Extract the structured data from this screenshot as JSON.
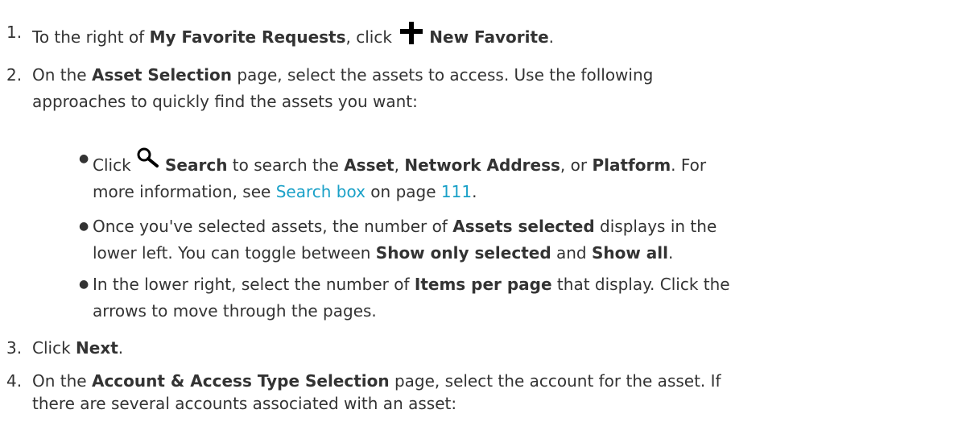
{
  "steps": [
    {
      "num": "1.",
      "t1": "To the right of ",
      "b1": "My Favorite Requests",
      "t2": ", click ",
      "b2": "New Favorite",
      "t3": "."
    },
    {
      "num": "2.",
      "t1": "On the ",
      "b1": "Asset Selection",
      "t2": " page, select the assets to access. Use the following",
      "t3": "approaches to quickly find the assets you want:"
    },
    {
      "num": "3.",
      "t1": "Click ",
      "b1": "Next",
      "t2": "."
    },
    {
      "num": "4.",
      "t1": "On the ",
      "b1": "Account & Access Type Selection",
      "t2": " page, select the account for the asset. If",
      "t3": "there are several accounts associated with an asset:"
    }
  ],
  "bullets": [
    {
      "t1": "Click ",
      "b1": "Search",
      "t2": " to search the ",
      "b2": "Asset",
      "t3": ", ",
      "b3": "Network Address",
      "t4": ", or ",
      "b4": "Platform",
      "t5": ". For",
      "t6": "more information, see ",
      "link1": "Search box",
      "t7": " on page ",
      "link2": "111",
      "t8": "."
    },
    {
      "t1": "Once you've selected assets, the number of ",
      "b1": "Assets selected",
      "t2": " displays in the",
      "t3": "lower left. You can toggle between ",
      "b2": "Show only selected",
      "t4": " and ",
      "b3": "Show all",
      "t5": "."
    },
    {
      "t1": "In the lower right, select the number of ",
      "b1": "Items per page",
      "t2": " that display. Click the",
      "t3": "arrows to move through the pages."
    }
  ],
  "icons": {
    "plus": "plus-icon",
    "search": "magnifier-icon"
  }
}
